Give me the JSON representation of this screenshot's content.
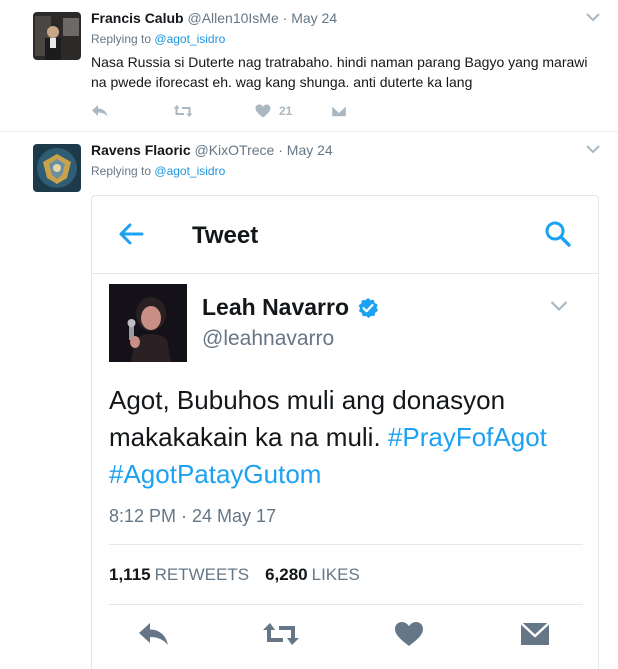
{
  "tweets": [
    {
      "fullname": "Francis Calub",
      "username": "@Allen10IsMe",
      "separator": "·",
      "time": "May 24",
      "replying_prefix": "Replying to",
      "replying_to": "@agot_isidro",
      "text": "Nasa Russia si Duterte nag tratrabaho. hindi naman parang Bagyo yang marawi na pwede iforecast eh. wag kang shunga. anti duterte ka lang",
      "like_count": "21"
    },
    {
      "fullname": "Ravens Flaoric",
      "username": "@KixOTrece",
      "separator": "·",
      "time": "May 24",
      "replying_prefix": "Replying to",
      "replying_to": "@agot_isidro"
    }
  ],
  "embedded": {
    "header_title": "Tweet",
    "name": "Leah Navarro",
    "handle": "@leahnavarro",
    "text_plain": "Agot, Bubuhos muli ang donasyon makakakain ka na muli.",
    "hashtag1": "#PrayFofAgot",
    "hashtag2": "#AgotPatayGutom",
    "timestamp": "8:12 PM · 24 May 17",
    "retweets_count": "1,115",
    "retweets_label": "RETWEETS",
    "likes_count": "6,280",
    "likes_label": "LIKES"
  },
  "colors": {
    "link_blue": "#1b95e0",
    "hashtag_blue": "#1da1f2",
    "muted_gray": "#657786",
    "icon_gray": "#aab8c2",
    "card_icon_gray": "#657786"
  }
}
